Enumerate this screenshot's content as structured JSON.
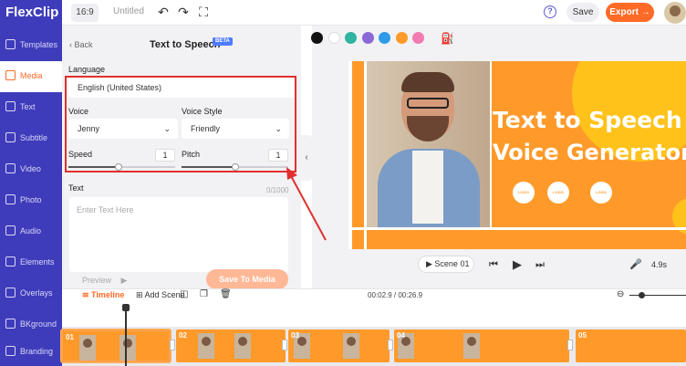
{
  "app": {
    "logo": "FlexClip",
    "ratio": "16:9",
    "project_title": "Untitled"
  },
  "header": {
    "save_label": "Save",
    "export_label": "Export →",
    "help_glyph": "?"
  },
  "sidebar": {
    "items": [
      {
        "label": "Templates",
        "icon": "templates-icon"
      },
      {
        "label": "Media",
        "icon": "media-icon",
        "active": true
      },
      {
        "label": "Text",
        "icon": "text-icon"
      },
      {
        "label": "Subtitle",
        "icon": "subtitle-icon"
      },
      {
        "label": "Video",
        "icon": "video-icon"
      },
      {
        "label": "Photo",
        "icon": "photo-icon"
      },
      {
        "label": "Audio",
        "icon": "audio-icon"
      },
      {
        "label": "Elements",
        "icon": "elements-icon"
      },
      {
        "label": "Overlays",
        "icon": "overlays-icon"
      },
      {
        "label": "BKground",
        "icon": "background-icon"
      },
      {
        "label": "Branding",
        "icon": "branding-icon"
      }
    ]
  },
  "panel": {
    "back_label": "Back",
    "title": "Text to Speech",
    "beta": "BETA",
    "language_label": "Language",
    "language_value": "English (United States)",
    "voice_label": "Voice",
    "voice_value": "Jenny",
    "voice_style_label": "Voice Style",
    "voice_style_value": "Friendly",
    "speed_label": "Speed",
    "speed_value": "1",
    "speed_level": 0.47,
    "pitch_label": "Pitch",
    "pitch_value": "1",
    "pitch_level": 0.5,
    "text_label": "Text",
    "text_counter": "0/1000",
    "text_placeholder": "Enter Text Here",
    "preview_label": "Preview",
    "save_to_media_label": "Save To Media"
  },
  "colors": [
    "#111111",
    "#ffffff",
    "#2fb4a0",
    "#8a6ad6",
    "#2f9be8",
    "#ff9a2a",
    "#f27ab0"
  ],
  "canvas": {
    "title_line1": "Text to Speech",
    "title_line2": "Voice Generator",
    "badges": [
      "LOGO PLACE",
      "LOGO PLACE",
      "LOGO PLACE"
    ],
    "scene_label": "Scene  01",
    "duration": "4.9s"
  },
  "timeline": {
    "label": "Timeline",
    "add_scene": "Add Scene",
    "time": "00:02.9 / 00:26.9",
    "clips": [
      "01",
      "02",
      "03",
      "04",
      "05"
    ]
  }
}
